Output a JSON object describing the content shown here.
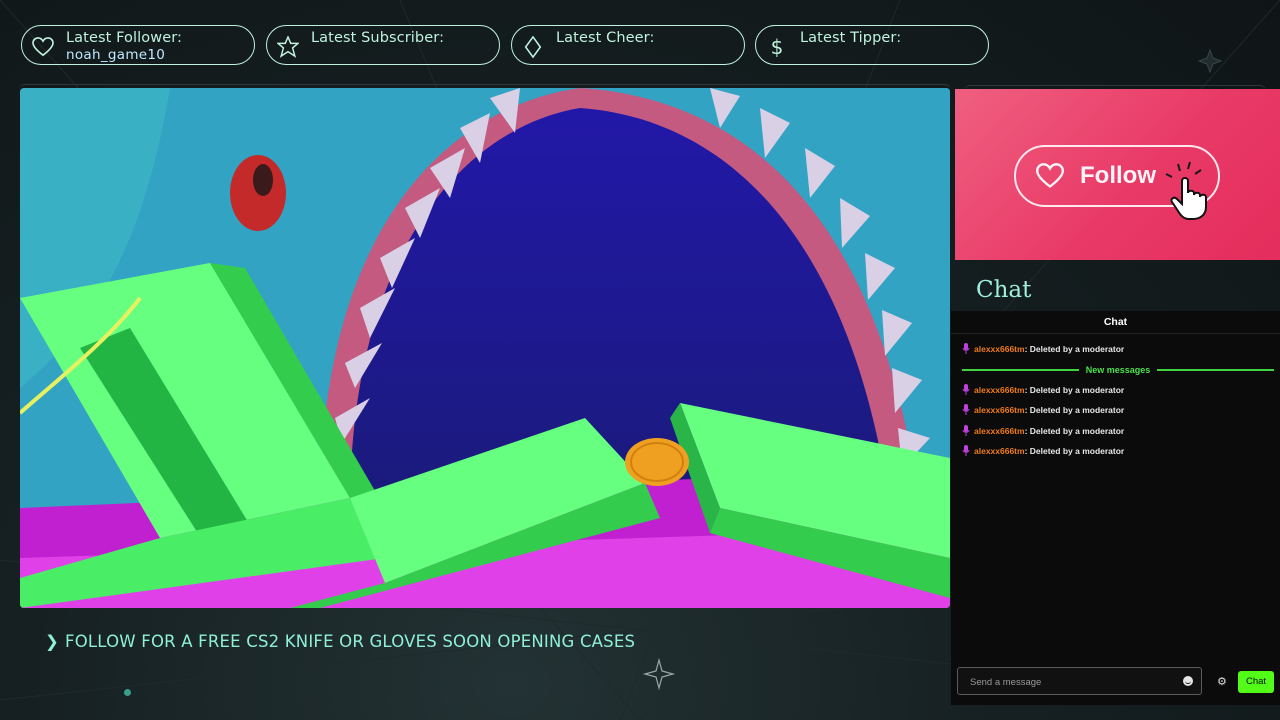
{
  "alerts": [
    {
      "label": "Latest Follower:",
      "value": "noah_game10",
      "icon": "heart-icon"
    },
    {
      "label": "Latest Subscriber:",
      "value": "",
      "icon": "star-icon"
    },
    {
      "label": "Latest Cheer:",
      "value": "",
      "icon": "diamond-icon"
    },
    {
      "label": "Latest Tipper:",
      "value": "",
      "icon": "dollar-icon"
    }
  ],
  "ticker": {
    "chevron": "❯",
    "text": "FOLLOW FOR A FREE CS2 KNIFE OR GLOVES SOON OPENING CASES"
  },
  "follow": {
    "label": "Follow"
  },
  "chat_section": {
    "heading": "Chat"
  },
  "chat": {
    "title": "Chat",
    "new_messages_label": "New messages",
    "messages": [
      {
        "user": "alexxx666tm",
        "text": ": Deleted by a moderator"
      },
      {
        "user": "alexxx666tm",
        "text": ": Deleted by a moderator"
      },
      {
        "user": "alexxx666tm",
        "text": ": Deleted by a moderator"
      },
      {
        "user": "alexxx666tm",
        "text": ": Deleted by a moderator"
      },
      {
        "user": "alexxx666tm",
        "text": ": Deleted by a moderator"
      }
    ],
    "input_placeholder": "Send a message",
    "send_label": "Chat"
  },
  "colors": {
    "accent": "#bff3de",
    "follow_panel": "#e93a67",
    "chat_send": "#53fc18",
    "username": "#f07b1a",
    "divider": "#3fd23f"
  }
}
